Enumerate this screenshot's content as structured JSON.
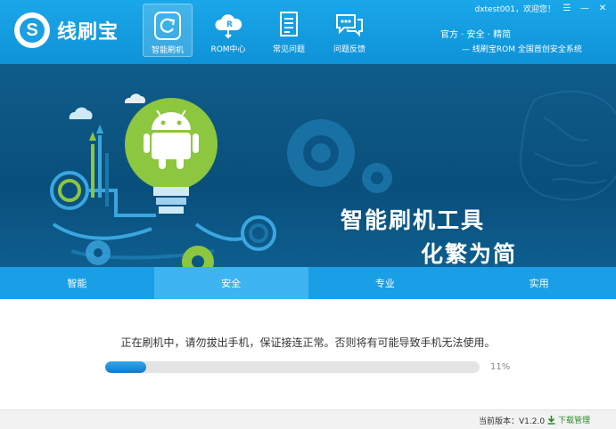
{
  "app": {
    "logo_text": "线刷宝",
    "logo_letter": "S"
  },
  "nav": [
    {
      "label": "智能刷机",
      "icon": "flash-refresh-icon",
      "active": true
    },
    {
      "label": "ROM中心",
      "icon": "cloud-rom-icon",
      "active": false
    },
    {
      "label": "常见问题",
      "icon": "document-icon",
      "active": false
    },
    {
      "label": "问题反馈",
      "icon": "chat-bubble-icon",
      "active": false
    }
  ],
  "user": {
    "greeting": "dxtest001，欢迎您！"
  },
  "slogan": {
    "line1": "官方 · 安全 · 精简",
    "line2": "— 线刷宝ROM  全国首创安全系统"
  },
  "banner": {
    "title_line1": "智能刷机工具",
    "title_line2": "化繁为简"
  },
  "tabs": [
    {
      "label": "智能",
      "active": false
    },
    {
      "label": "安全",
      "active": true
    },
    {
      "label": "专业",
      "active": false
    },
    {
      "label": "实用",
      "active": false
    }
  ],
  "status": {
    "message": "正在刷机中，请勿拔出手机，保证接连正常。否则将有可能导致手机无法使用。",
    "progress_percent": 11,
    "progress_label": "11%"
  },
  "footer": {
    "version": "当前版本：V1.2.0",
    "download_label": "下载管理"
  },
  "colors": {
    "header_blue": "#1aa7e9",
    "banner_navy": "#0a4f7b",
    "android_green": "#8dc63f",
    "progress_blue": "#1179c9"
  }
}
